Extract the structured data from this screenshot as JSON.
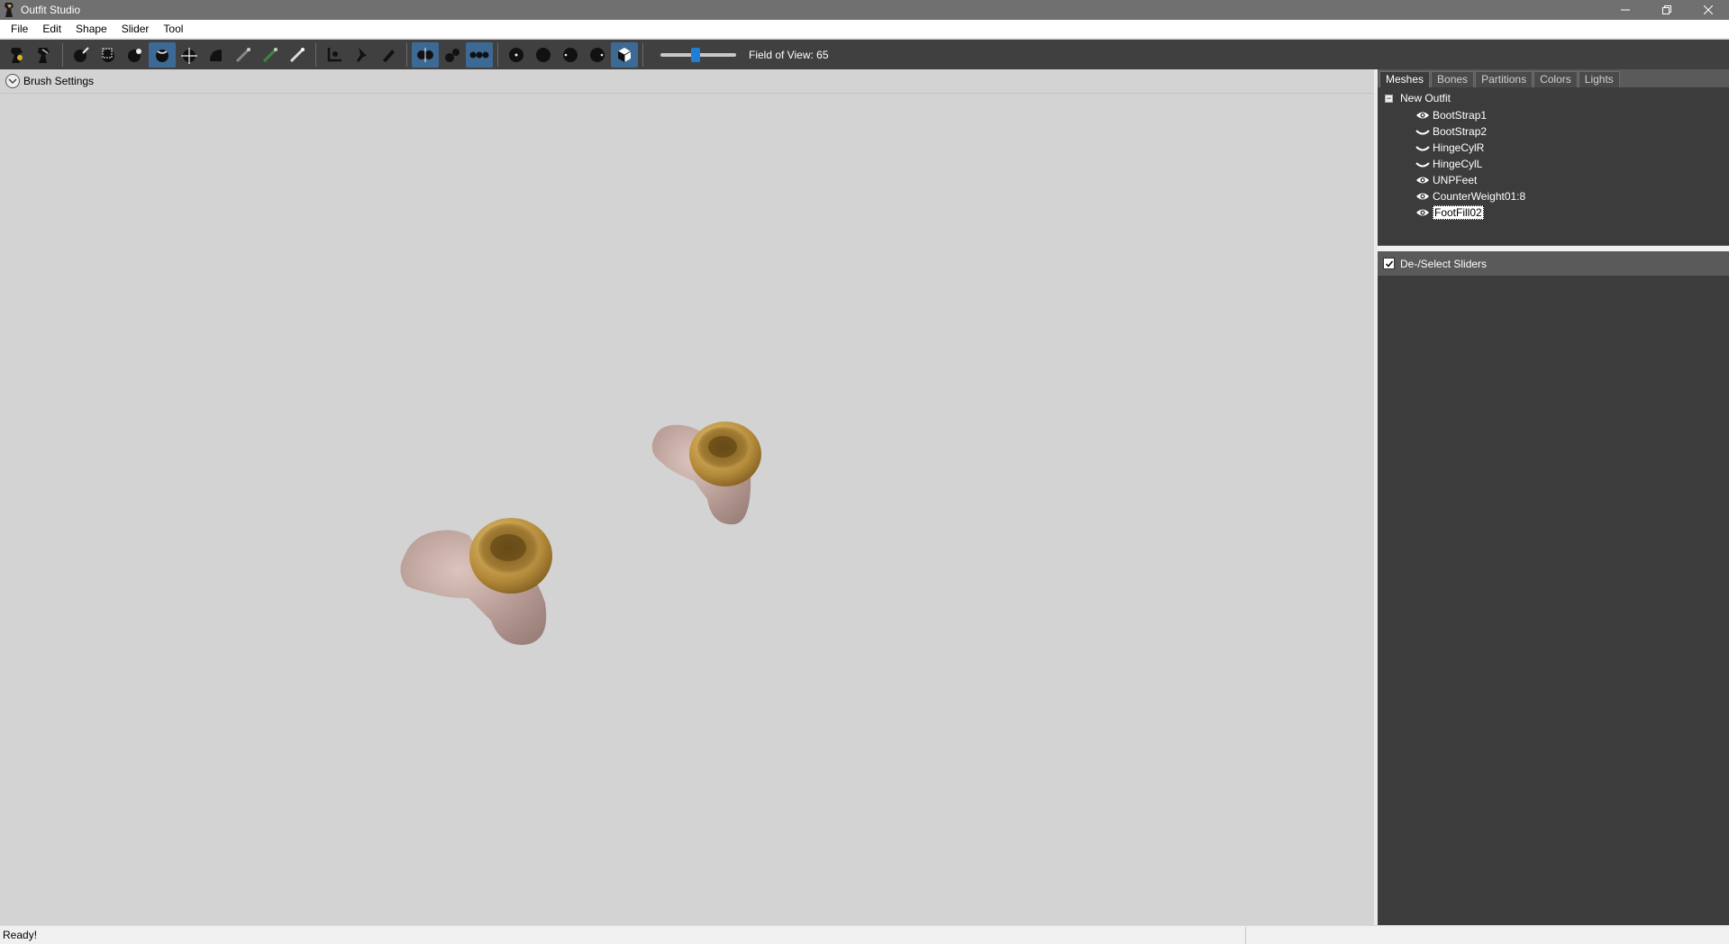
{
  "window": {
    "title": "Outfit Studio",
    "controls": [
      "minimize-icon",
      "restore-icon",
      "close-icon"
    ]
  },
  "menu": [
    {
      "label": "File"
    },
    {
      "label": "Edit"
    },
    {
      "label": "Shape"
    },
    {
      "label": "Slider"
    },
    {
      "label": "Tool"
    }
  ],
  "toolbar": {
    "fov_label": "Field of View: 65",
    "fov_value": 65
  },
  "viewport": {
    "brush_settings_label": "Brush Settings"
  },
  "tabs": [
    {
      "label": "Meshes",
      "active": true
    },
    {
      "label": "Bones",
      "active": false
    },
    {
      "label": "Partitions",
      "active": false
    },
    {
      "label": "Colors",
      "active": false
    },
    {
      "label": "Lights",
      "active": false
    }
  ],
  "meshes": {
    "root": "New Outfit",
    "items": [
      {
        "label": "BootStrap1",
        "visibility": "eye-icon"
      },
      {
        "label": "BootStrap2",
        "visibility": "eye-closed-icon"
      },
      {
        "label": "HingeCylR",
        "visibility": "eye-closed-icon"
      },
      {
        "label": "HingeCylL",
        "visibility": "eye-closed-icon"
      },
      {
        "label": "UNPFeet",
        "visibility": "eye-icon"
      },
      {
        "label": "CounterWeight01:8",
        "visibility": "eye-icon"
      },
      {
        "label": "FootFill02",
        "visibility": "eye-icon",
        "selected": true
      }
    ]
  },
  "sliders": {
    "deselect_label": "De-/Select Sliders",
    "checked": true
  },
  "status": {
    "text": "Ready!"
  },
  "colors": {
    "titlebar": "#707070",
    "toolbar": "#404040",
    "viewport": "#d3d3d3",
    "panel": "#3c3c3c",
    "accent": "#1e7fd6"
  }
}
